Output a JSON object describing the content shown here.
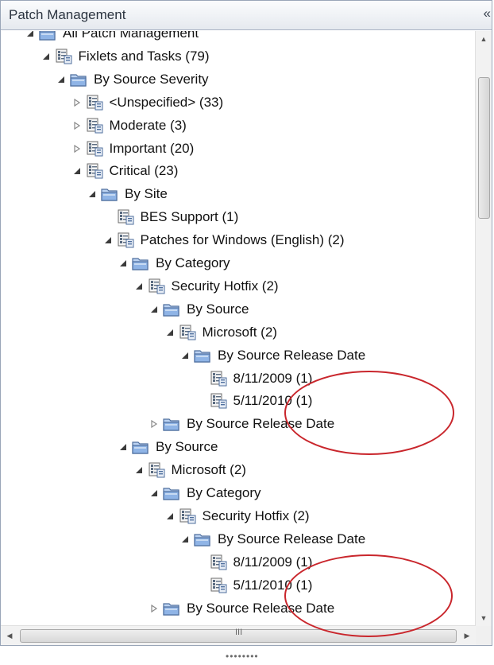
{
  "panel": {
    "title": "Patch Management",
    "collapse_label": "«"
  },
  "colors": {
    "annotation": "#c9262c",
    "folder": "#8fb4e6",
    "header_bg": "#e5e9ef"
  },
  "tree": [
    {
      "label": "All Patch Management",
      "level": 0,
      "expander": "expanded",
      "icon": "folder"
    },
    {
      "label": "Fixlets and Tasks (79)",
      "level": 1,
      "expander": "expanded",
      "icon": "list"
    },
    {
      "label": "By Source Severity",
      "level": 2,
      "expander": "expanded",
      "icon": "folder"
    },
    {
      "label": "<Unspecified> (33)",
      "level": 3,
      "expander": "collapsed",
      "icon": "list"
    },
    {
      "label": "Moderate (3)",
      "level": 3,
      "expander": "collapsed",
      "icon": "list"
    },
    {
      "label": "Important (20)",
      "level": 3,
      "expander": "collapsed",
      "icon": "list"
    },
    {
      "label": "Critical (23)",
      "level": 3,
      "expander": "expanded",
      "icon": "list"
    },
    {
      "label": "By Site",
      "level": 4,
      "expander": "expanded",
      "icon": "folder"
    },
    {
      "label": "BES Support (1)",
      "level": 5,
      "expander": "none",
      "icon": "list"
    },
    {
      "label": "Patches for Windows (English) (2)",
      "level": 5,
      "expander": "expanded",
      "icon": "list"
    },
    {
      "label": "By Category",
      "level": 6,
      "expander": "expanded",
      "icon": "folder"
    },
    {
      "label": "Security Hotfix (2)",
      "level": 7,
      "expander": "expanded",
      "icon": "list"
    },
    {
      "label": "By Source",
      "level": 8,
      "expander": "expanded",
      "icon": "folder"
    },
    {
      "label": "Microsoft (2)",
      "level": 9,
      "expander": "expanded",
      "icon": "list"
    },
    {
      "label": "By Source Release Date",
      "level": 10,
      "expander": "expanded",
      "icon": "folder"
    },
    {
      "label": "8/11/2009 (1)",
      "level": 11,
      "expander": "none",
      "icon": "list"
    },
    {
      "label": "5/11/2010 (1)",
      "level": 11,
      "expander": "none",
      "icon": "list"
    },
    {
      "label": "By Source Release Date",
      "level": 8,
      "expander": "collapsed",
      "icon": "folder"
    },
    {
      "label": "By Source",
      "level": 6,
      "expander": "expanded",
      "icon": "folder"
    },
    {
      "label": "Microsoft (2)",
      "level": 7,
      "expander": "expanded",
      "icon": "list"
    },
    {
      "label": "By Category",
      "level": 8,
      "expander": "expanded",
      "icon": "folder"
    },
    {
      "label": "Security Hotfix (2)",
      "level": 9,
      "expander": "expanded",
      "icon": "list"
    },
    {
      "label": "By Source Release Date",
      "level": 10,
      "expander": "expanded",
      "icon": "folder"
    },
    {
      "label": "8/11/2009 (1)",
      "level": 11,
      "expander": "none",
      "icon": "list"
    },
    {
      "label": "5/11/2010 (1)",
      "level": 11,
      "expander": "none",
      "icon": "list"
    },
    {
      "label": "By Source Release Date",
      "level": 8,
      "expander": "collapsed",
      "icon": "folder"
    }
  ],
  "scrollbars": {
    "up_arrow": "▲",
    "down_arrow": "▼",
    "left_arrow": "◀",
    "right_arrow": "▶",
    "grip": "III"
  }
}
